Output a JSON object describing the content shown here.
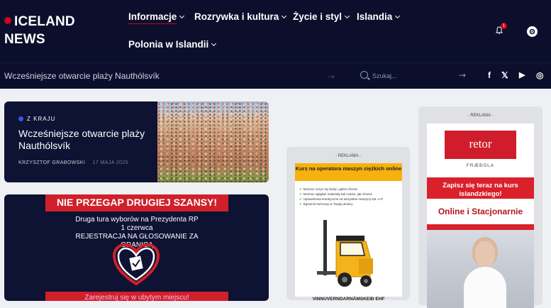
{
  "header": {
    "logo_line1": "ICELAND",
    "logo_line2": "NEWS",
    "nav": [
      {
        "label": "Informacje",
        "active": true
      },
      {
        "label": "Rozrywka i kultura"
      },
      {
        "label": "Życie i styl"
      },
      {
        "label": "Islandia"
      },
      {
        "label": "Polonia w Islandii"
      }
    ],
    "notification_count": "1"
  },
  "subbar": {
    "ticker": "Wcześniejsze otwarcie plaży Nauthólsvík",
    "search_placeholder": "Szukaj...",
    "social": [
      "f",
      "𝕏",
      "▶",
      "◎"
    ]
  },
  "feature": {
    "category": "Z KRAJU",
    "title": "Wcześniejsze otwarcie plaży Nauthólsvík",
    "author": "KRZYSZTOF GRABOWSKI",
    "date": "17 MAJA 2025"
  },
  "banner": {
    "top": "NIE PRZEGAP DRUGIEJ SZANSY!",
    "line1": "Druga tura wyborów na Prezydenta RP",
    "line2": "1 czerwca",
    "line3": "REJESTRACJA NA GŁOSOWANIE ZA",
    "line4": "GRANICĄ",
    "bottom": "Zarejestruj się w ubytym miejscu!"
  },
  "ads": {
    "label": "- REKLAMA -",
    "ad1": {
      "headline": "Kurs na operatora maszyn ciężkich online",
      "bullets": [
        "Możesz uczyć się kiedy i gdzie chcesz",
        "Możesz oglądać materiały tak często, jak chcesz",
        "Uprawnienia teoretyczne na wszystkie maszyny kat. A-P",
        "Egzamin końcowy w Twojej okolicy"
      ],
      "footer": "VINNUVERNDARNÁMSKEIÐ EHF"
    },
    "ad2": {
      "logo": "retor",
      "sub": "FRÆÐSLA",
      "cta": "Zapisz się teraz na kurs islandzkiego!",
      "mode": "Online i Stacjonarnie"
    }
  },
  "colors": {
    "header_bg": "#0b0f2c",
    "accent": "#d0021b",
    "card_bg": "#0e1233",
    "category_dot": "#3653e8"
  }
}
